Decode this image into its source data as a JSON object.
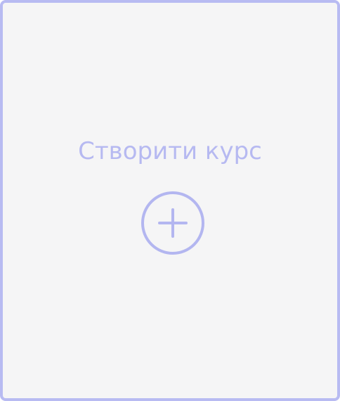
{
  "card": {
    "title": "Створити курс",
    "icon": "plus-circle-icon",
    "accent_color": "#b8bbf2",
    "background_color": "#f5f5f6"
  }
}
